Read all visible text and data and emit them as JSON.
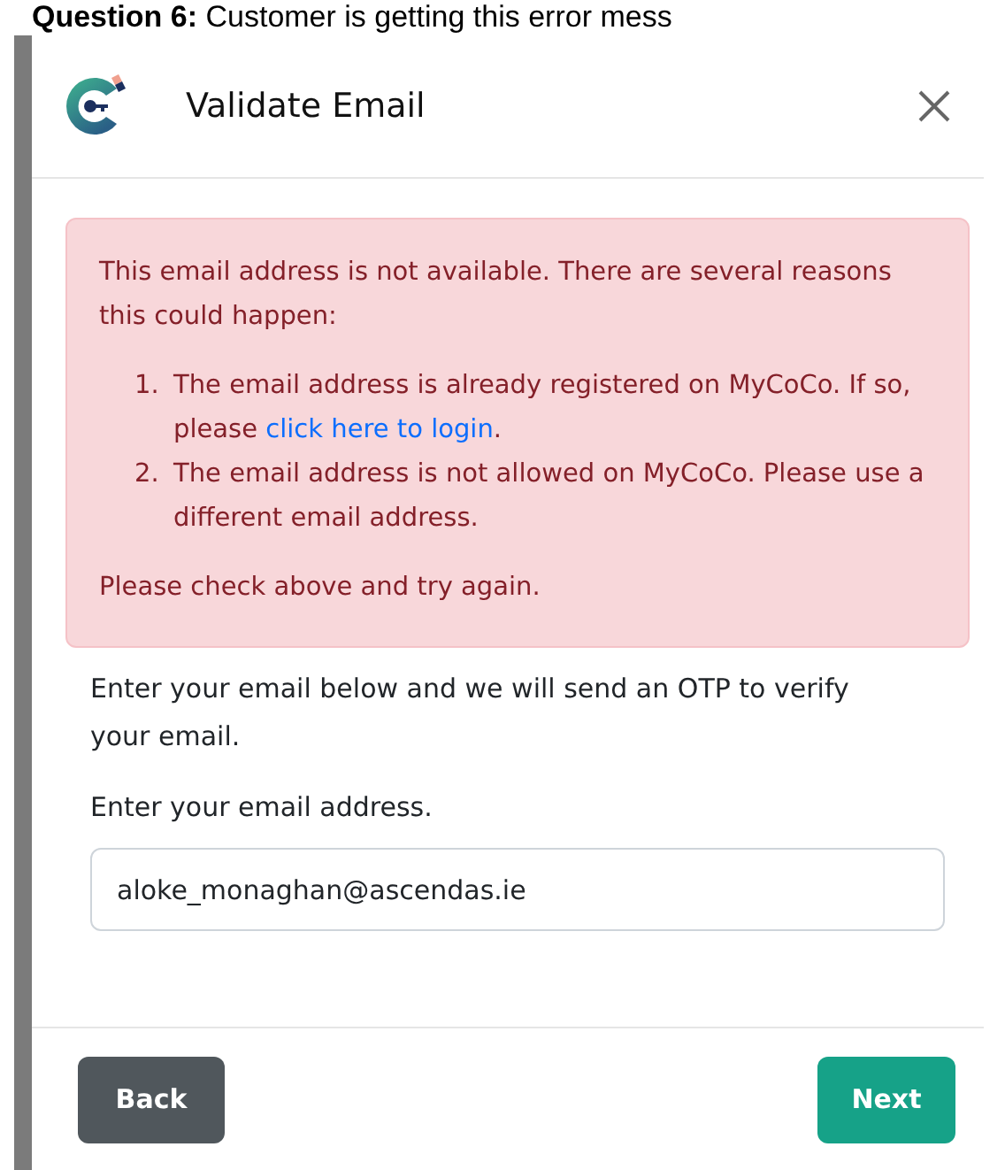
{
  "page_heading": "**Question 6:** Customer is getting this error mess",
  "dialog": {
    "title": "Validate Email",
    "alert": {
      "intro": "This email address is not available. There are several reasons this could happen:",
      "reasons": [
        {
          "number": "1.",
          "text": "The email address is already registered on MyCoCo. If so, please ",
          "link": "click here to login",
          "after": "."
        },
        {
          "number": "2.",
          "text": "The email address is not allowed on MyCoCo. Please use a different email address."
        }
      ],
      "footer": "Please check above and try again."
    },
    "instructions": "Enter your email below and we will send an OTP to verify your email.",
    "email_label": "Enter your email address.",
    "email_value": "aloke_monaghan@ascendas.ie",
    "buttons": [
      {
        "label": "Back",
        "kind": "secondary"
      },
      {
        "label": "Next",
        "kind": "primary"
      }
    ]
  }
}
